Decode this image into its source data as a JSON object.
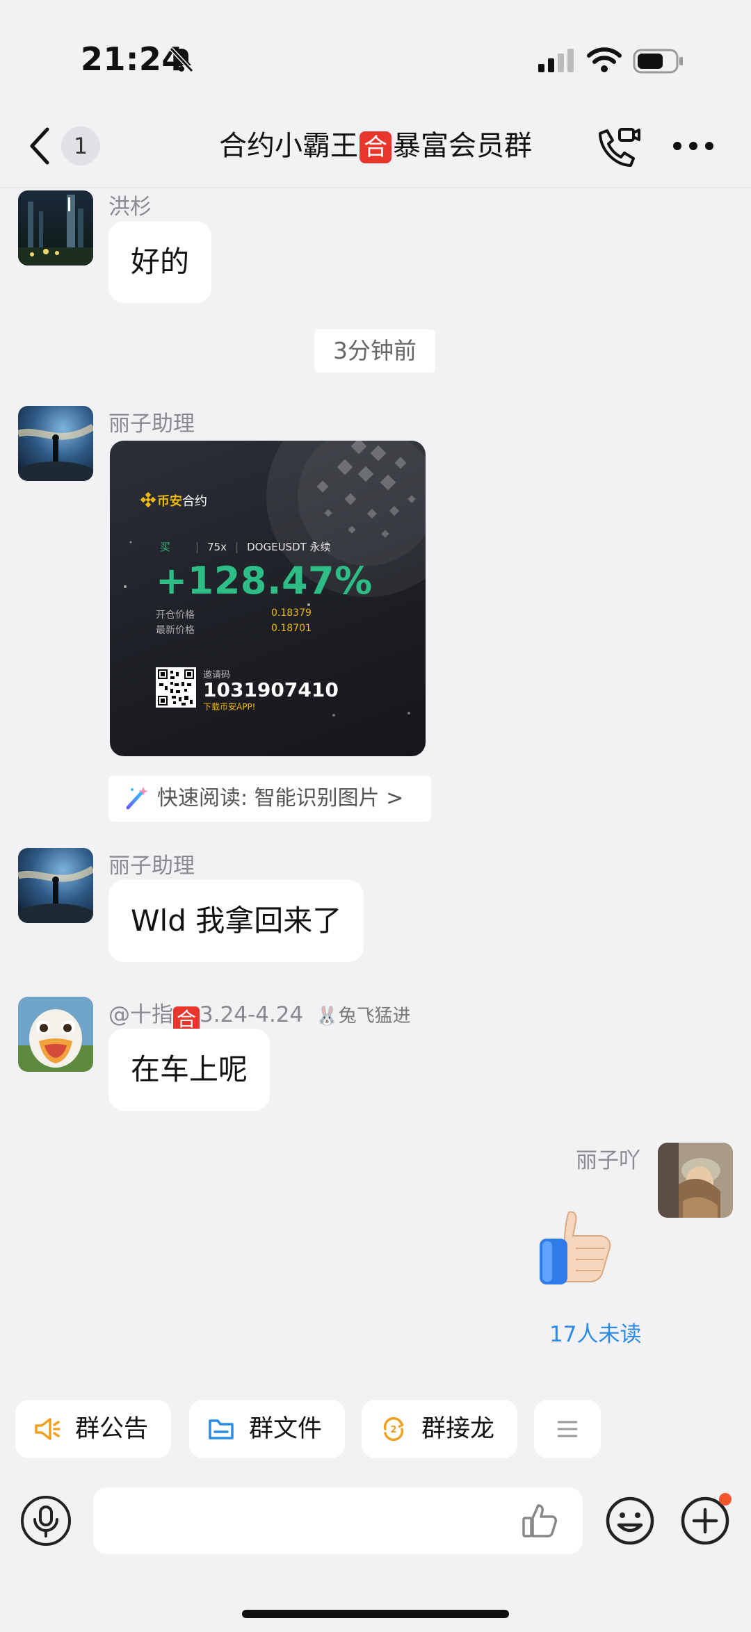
{
  "status_bar": {
    "time": "21:24",
    "icons": [
      "bell-slash-icon",
      "signal-icon",
      "wifi-icon",
      "battery-icon"
    ]
  },
  "nav": {
    "back_icon": "chevron-left-icon",
    "unread_count": "1",
    "title_part1": "合约小霸王",
    "title_badge": "合",
    "title_part2": "暴富会员群",
    "call_icon": "video-call-icon",
    "more_icon": "more-icon"
  },
  "messages": [
    {
      "sender": "洪杉",
      "text": "好的"
    },
    {
      "time_divider": "3分钟前"
    },
    {
      "sender": "丽子助理",
      "card": {
        "brand": "币安",
        "brand_suffix": "合约",
        "side": "买",
        "leverage": "75x",
        "symbol": "DOGEUSDT 永续",
        "pnl": "+128.47%",
        "open_label": "开仓价格",
        "open_price": "0.18379",
        "last_label": "最新价格",
        "last_price": "0.18701",
        "invite_label": "邀请码",
        "invite_code": "1031907410",
        "download_text": "下载币安APP!"
      },
      "quick_read": "快速阅读: 智能识别图片 >"
    },
    {
      "sender": "丽子助理",
      "text": "Wld 我拿回来了"
    },
    {
      "sender_prefix": "@十指",
      "sender_badge": "合",
      "sender_suffix": "3.24-4.24",
      "sender_title": "兔飞猛进",
      "text": "在车上呢"
    },
    {
      "sender": "丽子吖",
      "sticker": "thumbs-up-icon",
      "read_status": "17人未读"
    }
  ],
  "quick_actions": [
    {
      "label": "群公告",
      "icon": "megaphone-icon"
    },
    {
      "label": "群文件",
      "icon": "folder-icon"
    },
    {
      "label": "群接龙",
      "icon": "relay-icon"
    },
    {
      "label": "",
      "icon": "menu-icon"
    }
  ],
  "input_bar": {
    "voice_icon": "mic-icon",
    "like_icon": "thumbs-up-outline-icon",
    "emoji_icon": "emoji-icon",
    "plus_icon": "plus-icon"
  },
  "colors": {
    "accent_blue": "#2b8ce8",
    "badge_red": "#e8362c",
    "profit_green": "#2ebd85",
    "binance_yellow": "#f0b90b"
  }
}
